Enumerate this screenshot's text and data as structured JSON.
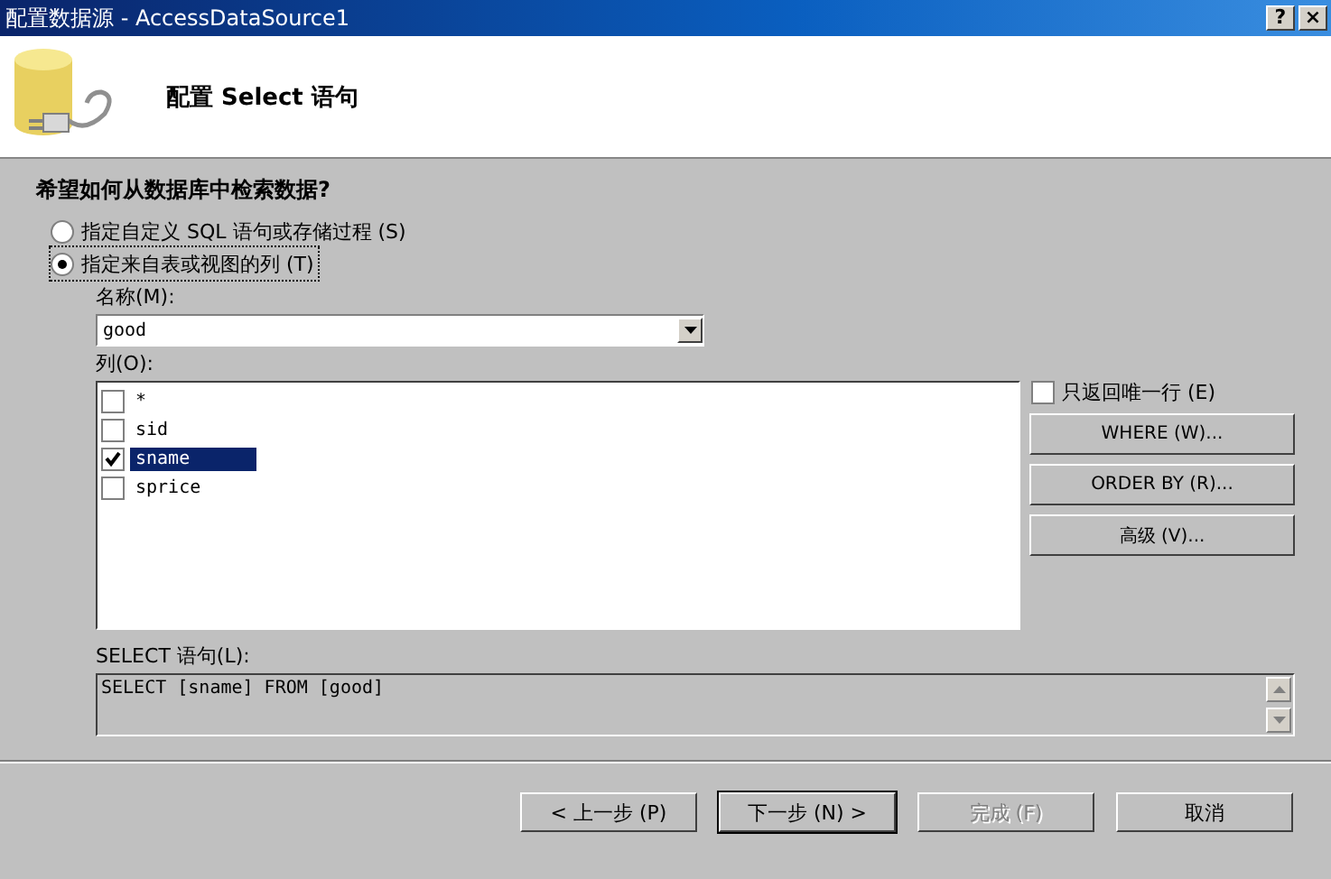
{
  "window": {
    "title": "配置数据源 - AccessDataSource1",
    "title_buttons": [
      "?",
      "×"
    ]
  },
  "header": {
    "title": "配置 Select 语句"
  },
  "question": "希望如何从数据库中检索数据?",
  "options": [
    {
      "label": "指定自定义 SQL 语句或存储过程 (S)",
      "selected": false
    },
    {
      "label": "指定来自表或视图的列 (T)",
      "selected": true
    }
  ],
  "name_label": "名称(M):",
  "name_combo": {
    "value": "good"
  },
  "columns_label": "列(O):",
  "columns": [
    {
      "name": "*",
      "checked": false,
      "selected": false
    },
    {
      "name": "sid",
      "checked": false,
      "selected": false
    },
    {
      "name": "sname",
      "checked": true,
      "selected": true
    },
    {
      "name": "sprice",
      "checked": false,
      "selected": false
    }
  ],
  "unique_rows": {
    "label": "只返回唯一行 (E)",
    "checked": false
  },
  "side_buttons": [
    "WHERE (W)...",
    "ORDER BY (R)...",
    "高级 (V)..."
  ],
  "sql_label": "SELECT 语句(L):",
  "sql": "SELECT [sname] FROM [good]",
  "footer_buttons": [
    {
      "label": "< 上一步 (P)",
      "disabled": false,
      "default": false
    },
    {
      "label": "下一步 (N) >",
      "disabled": false,
      "default": true
    },
    {
      "label": "完成 (F)",
      "disabled": true,
      "default": false
    },
    {
      "label": "取消",
      "disabled": false,
      "default": false
    }
  ]
}
